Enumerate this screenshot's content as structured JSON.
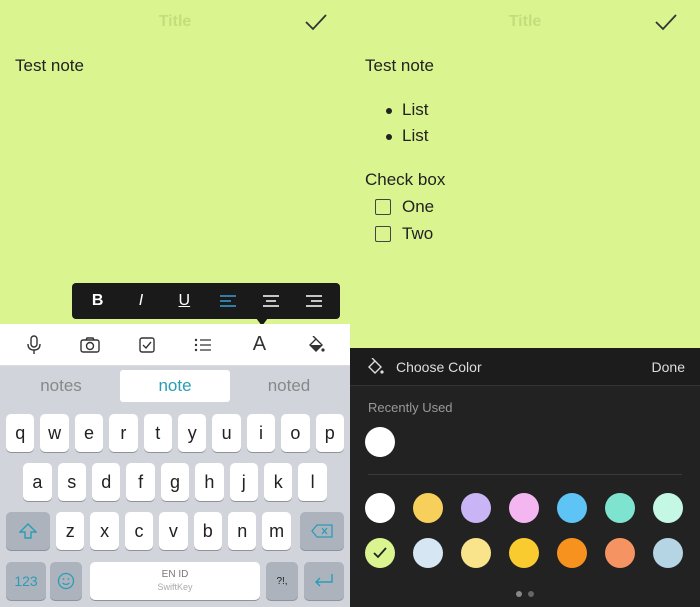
{
  "left": {
    "title": "Title",
    "note_text": "Test note",
    "format_toolbar": [
      "B",
      "I",
      "U",
      "align-left",
      "align-center",
      "align-right"
    ],
    "accessory_icons": [
      "microphone-icon",
      "camera-icon",
      "checkbox-icon",
      "list-icon",
      "font-icon",
      "paint-bucket-icon"
    ],
    "accessory_font_label": "A",
    "suggestions": [
      "notes",
      "note",
      "noted"
    ],
    "keyboard": {
      "row1": [
        "q",
        "w",
        "e",
        "r",
        "t",
        "y",
        "u",
        "i",
        "o",
        "p"
      ],
      "row2": [
        "a",
        "s",
        "d",
        "f",
        "g",
        "h",
        "j",
        "k",
        "l"
      ],
      "row3": [
        "z",
        "x",
        "c",
        "v",
        "b",
        "n",
        "m"
      ],
      "numbers_label": "123",
      "space_label": "EN ID",
      "space_sub": "SwiftKey",
      "punct_label": "?!,"
    }
  },
  "right": {
    "title": "Title",
    "note_text": "Test note",
    "bullets": [
      "List",
      "List"
    ],
    "checkbox_heading": "Check box",
    "checkboxes": [
      "One",
      "Two"
    ],
    "picker": {
      "label": "Choose Color",
      "done": "Done",
      "recently_used": "Recently Used"
    }
  },
  "colors": {
    "note_bg": "#daf48f",
    "accent": "#2a9db5"
  }
}
